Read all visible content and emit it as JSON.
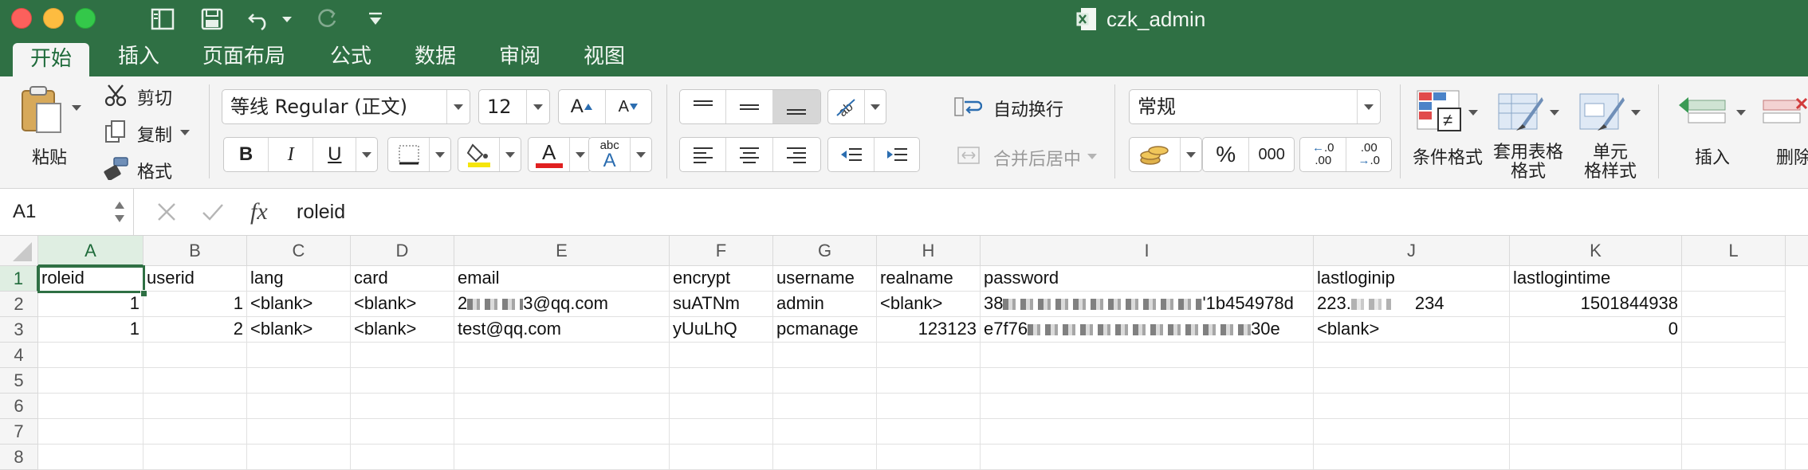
{
  "window": {
    "title": "czk_admin"
  },
  "tabs": [
    "开始",
    "插入",
    "页面布局",
    "公式",
    "数据",
    "审阅",
    "视图"
  ],
  "ribbon": {
    "paste_label": "粘贴",
    "cut_label": "剪切",
    "copy_label": "复制",
    "format_painter_label": "格式",
    "font_name": "等线 Regular (正文)",
    "font_size": "12",
    "bold": "B",
    "italic": "I",
    "underline": "U",
    "wrap_text_label": "自动换行",
    "merge_center_label": "合并后居中",
    "number_format": "常规",
    "percent": "%",
    "comma": "000",
    "inc_decimal": ".00",
    "dec_decimal": ".0",
    "conditional_format_label": "条件格式",
    "table_format_label_1": "套用表格",
    "table_format_label_2": "格式",
    "cell_style_label_1": "单元",
    "cell_style_label_2": "格样式",
    "insert_label": "插入",
    "delete_label": "删除"
  },
  "formula_bar": {
    "name_box": "A1",
    "fx": "fx",
    "content": "roleid"
  },
  "columns": [
    "A",
    "B",
    "C",
    "D",
    "E",
    "F",
    "G",
    "H",
    "I",
    "J",
    "K",
    "L"
  ],
  "rows": [
    "1",
    "2",
    "3",
    "4",
    "5",
    "6",
    "7",
    "8"
  ],
  "cells": {
    "r1": [
      "roleid",
      "userid",
      "lang",
      "card",
      "email",
      "encrypt",
      "username",
      "realname",
      "password",
      "lastloginip",
      "lastlogintime",
      ""
    ],
    "r2": [
      "1",
      "1",
      "<blank>",
      "<blank>",
      "2",
      "suATNm",
      "admin",
      "<blank>",
      "38",
      "223.",
      "1501844938",
      ""
    ],
    "r2_extra": {
      "email_tail": "3@qq.com",
      "password_tail": "'1b454978d",
      "ip_tail": "234"
    },
    "r3": [
      "1",
      "2",
      "<blank>",
      "<blank>",
      "test@qq.com",
      "yUuLhQ",
      "pcmanage",
      "123123",
      "e7f76",
      "<blank>",
      "0",
      ""
    ],
    "r3_extra": {
      "password_tail": "30e"
    }
  },
  "colors": {
    "accent": "#2f7044",
    "ribbon_bg": "#f4f4f4"
  }
}
